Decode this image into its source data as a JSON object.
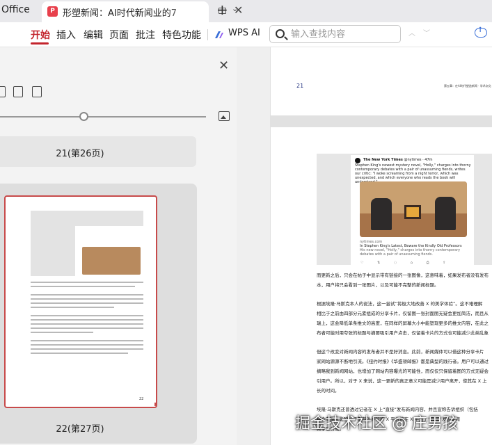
{
  "titlebar": {
    "app_name": "Office",
    "tab_title": "形塑新闻：AI时代新闻业的7",
    "tab_icon_glyph": "P",
    "close_glyph": "✕",
    "new_tab_glyph": "+",
    "tab_list_glyph": "⌄"
  },
  "ribbon": {
    "menu": [
      "开始",
      "插入",
      "编辑",
      "页面",
      "批注",
      "特色功能"
    ],
    "active_menu": "开始",
    "wps_ai_label": "WPS AI",
    "search_placeholder": "输入查找内容",
    "accent_color": "#c3252d"
  },
  "left_panel": {
    "close_glyph": "✕",
    "page_label": "21(第26页)",
    "thumbnail_caption": "22(第27页)",
    "thumbnail_page_number": "22"
  },
  "document": {
    "top_page_number": "21",
    "top_page_header": "第五章：在AI时代塑造新闻 · 学术文化",
    "tweet": {
      "account": "The New York Times",
      "handle": "@nytimes · 47m",
      "text": "Stephen King's newest mystery novel, \"Holly,\" charges into thorny contemporary debates with a pair of unassuming fiends, writes our critic: \"I woke screaming from a night terror, which was unexpected, and which everyone who reads the book will understand.\"",
      "link_domain": "nytimes.com",
      "link_title": "In Stephen King's Latest, Beware the Kindly Old Professors",
      "link_sub": "His new novel, \"Holly,\" charges into thorny contemporary debates with a pair of unassuming fiends.",
      "actions": "♡ ⇅ ◌ ⌂ ⎙ ⇪"
    },
    "paragraphs": [
      "而更新之后，只会在帖子中显示带有链接的一张图像，这意味着，如果发布者没有发布",
      "本，用户将只会看到一张图片，以及可能不完整的新闻标题。",
      "根据埃隆·马斯克本人的说法，这一尝试“将极大地改善 X 的美学体验”。这不难理解",
      "相比于之前由四部分元素组成的分享卡片，仅留图一张封面图无疑会更加简洁，而且从",
      "瑞上，这会降低单条推文的高度，在同样的屏幕大小中能塑现更多的推文内容，在此之",
      "布者可能时用夸张的标题与摘要吸引用户点击，仅留着卡片的方式也可能减少此类乱象",
      "但这个改变对新闻内容的发布者并不是好消息。此前，新闻媒体可以借这种分享卡片",
      "家网站源源不断地引流。《纽约时报》《华盛顿邮报》都是典型的践行者。用户可以通过",
      "摘略我到新闻网站，也增加了网站内容曝光的可能性，而仅仅只保留着图的方式无疑会",
      "引用户。所以，对于 X 来说，这一更新的真正意义可能是减少用户离开，使其在 X 上",
      "长的时间。",
      "埃隆·马斯克还曾透过记者在 X 上“直接”发布新闻内容，并且宣称告诉组织（包括",
      "将会有重大影响。于是有外界分析 X 平台将在 X 平台上“直接”发布新闻",
      "频享受分成。"
    ],
    "watermark": "掘金技术社区 @ 庄男孩"
  }
}
